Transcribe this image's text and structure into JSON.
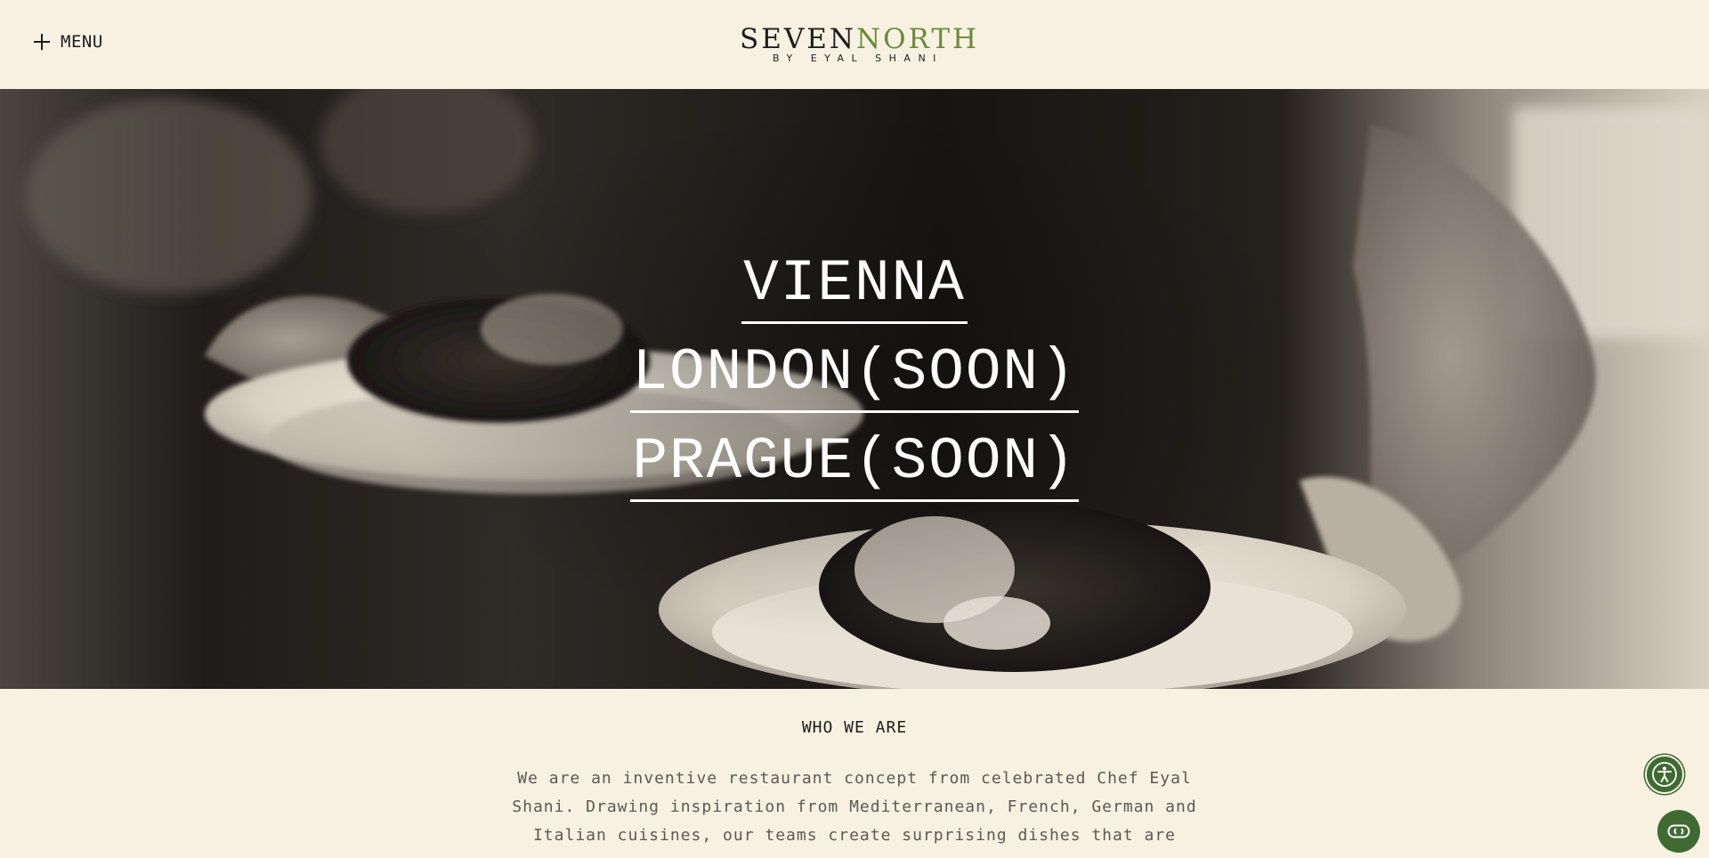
{
  "header": {
    "menu_label": "MENU",
    "logo": {
      "word1": "SEVEN",
      "word2": "NORTH",
      "subtitle": "BY EYAL SHANI"
    }
  },
  "hero": {
    "locations": [
      {
        "label": "VIENNA"
      },
      {
        "label": "LONDON(SOON)"
      },
      {
        "label": "PRAGUE(SOON)"
      }
    ]
  },
  "about": {
    "title": "WHO WE ARE",
    "text": "We are an inventive restaurant concept from celebrated Chef Eyal Shani. Drawing inspiration from Mediterranean, French, German and Italian cuisines, our teams create surprising dishes that are"
  },
  "icons": {
    "menu": "plus-icon",
    "accessibility": "accessibility-icon",
    "chat": "chat-icon"
  },
  "colors": {
    "background": "#f8f1e2",
    "brand_green": "#6a8a3a",
    "button_green": "#3f6b33",
    "text": "#1d1d1b"
  }
}
